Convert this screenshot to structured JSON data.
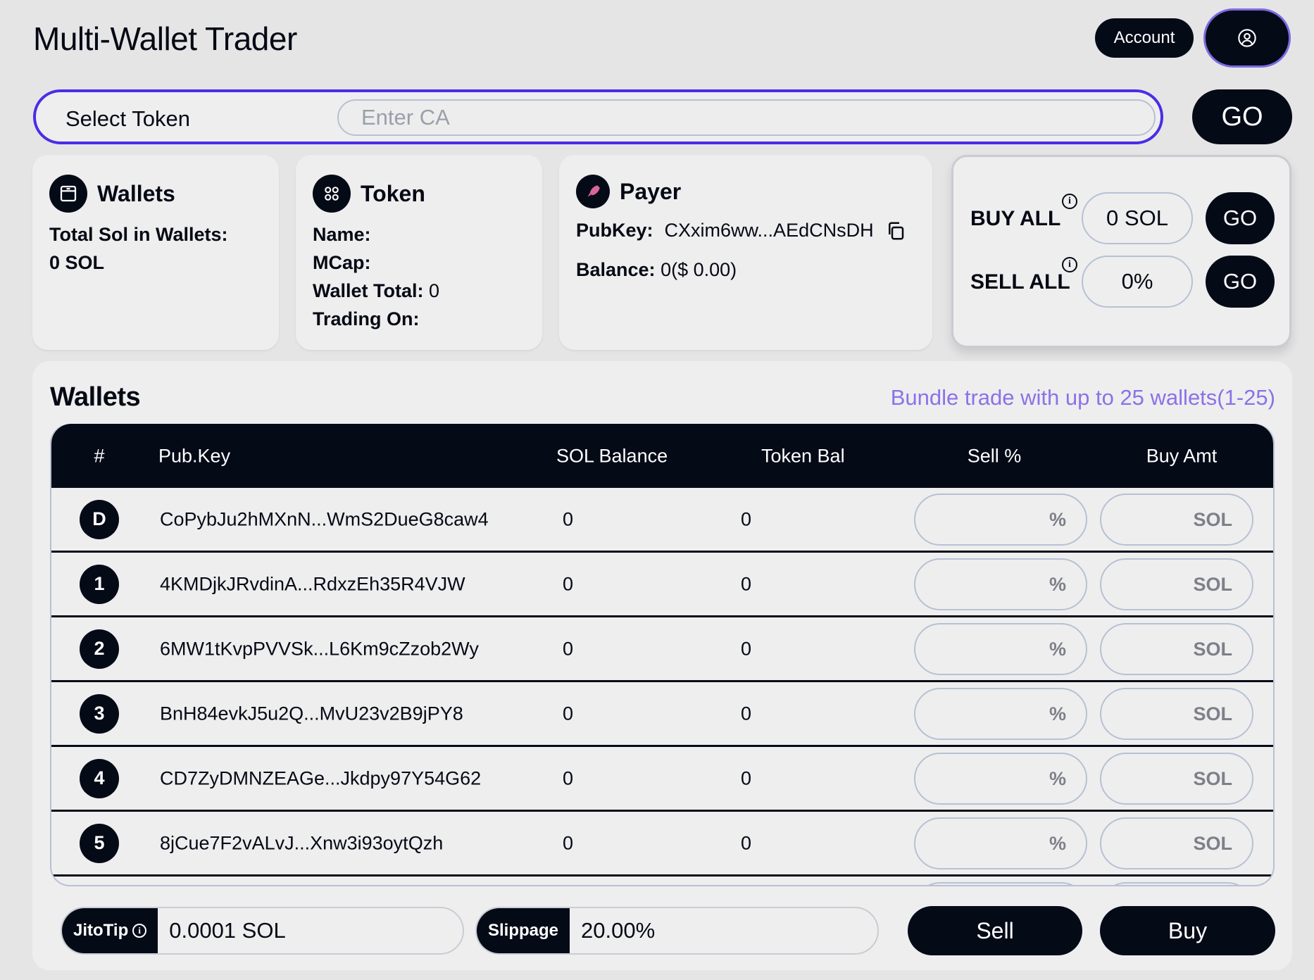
{
  "header": {
    "title": "Multi-Wallet Trader",
    "account_label": "Account",
    "avatar_icon": "user-circle-icon"
  },
  "token_bar": {
    "select_label": "Select Token",
    "ca_placeholder": "Enter CA",
    "go_label": "GO"
  },
  "cards": {
    "wallets": {
      "title": "Wallets",
      "total_label": "Total Sol in Wallets:",
      "total_value": "0 SOL"
    },
    "token": {
      "title": "Token",
      "name_label": "Name:",
      "mcap_label": "MCap:",
      "wallet_total_label": "Wallet Total:",
      "wallet_total_value": "0",
      "trading_on_label": "Trading On:"
    },
    "payer": {
      "title": "Payer",
      "pubkey_label": "PubKey:",
      "pubkey_value": "CXxim6ww...AEdCNsDH",
      "balance_label": "Balance:",
      "balance_value": "0($ 0.00)"
    }
  },
  "bulk": {
    "buy_label": "BUY ALL",
    "buy_value": "0 SOL",
    "sell_label": "SELL ALL",
    "sell_value": "0%",
    "go_label": "GO"
  },
  "wallets_panel": {
    "title": "Wallets",
    "bundle_note": "Bundle trade with up to 25 wallets(1-25)",
    "columns": [
      "#",
      "Pub.Key",
      "SOL Balance",
      "Token Bal",
      "Sell %",
      "Buy Amt"
    ],
    "rows": [
      {
        "id": "D",
        "pubkey": "CoPybJu2hMXnN...WmS2DueG8caw4",
        "sol": "0",
        "token": "0"
      },
      {
        "id": "1",
        "pubkey": "4KMDjkJRvdinA...RdxzEh35R4VJW",
        "sol": "0",
        "token": "0"
      },
      {
        "id": "2",
        "pubkey": "6MW1tKvpPVVSk...L6Km9cZzob2Wy",
        "sol": "0",
        "token": "0"
      },
      {
        "id": "3",
        "pubkey": "BnH84evkJ5u2Q...MvU23v2B9jPY8",
        "sol": "0",
        "token": "0"
      },
      {
        "id": "4",
        "pubkey": "CD7ZyDMNZEAGe...Jkdpy97Y54G62",
        "sol": "0",
        "token": "0"
      },
      {
        "id": "5",
        "pubkey": "8jCue7F2vALvJ...Xnw3i93oytQzh",
        "sol": "0",
        "token": "0"
      }
    ],
    "sell_unit": "%",
    "buy_unit": "SOL"
  },
  "footer": {
    "jito_label": "JitoTip",
    "jito_value": "0.0001 SOL",
    "slippage_label": "Slippage",
    "slippage_value": "20.00%",
    "sell_label": "Sell",
    "buy_label": "Buy"
  },
  "colors": {
    "accent": "#4a2de6",
    "dark": "#050a17",
    "link": "#8b72e6"
  }
}
